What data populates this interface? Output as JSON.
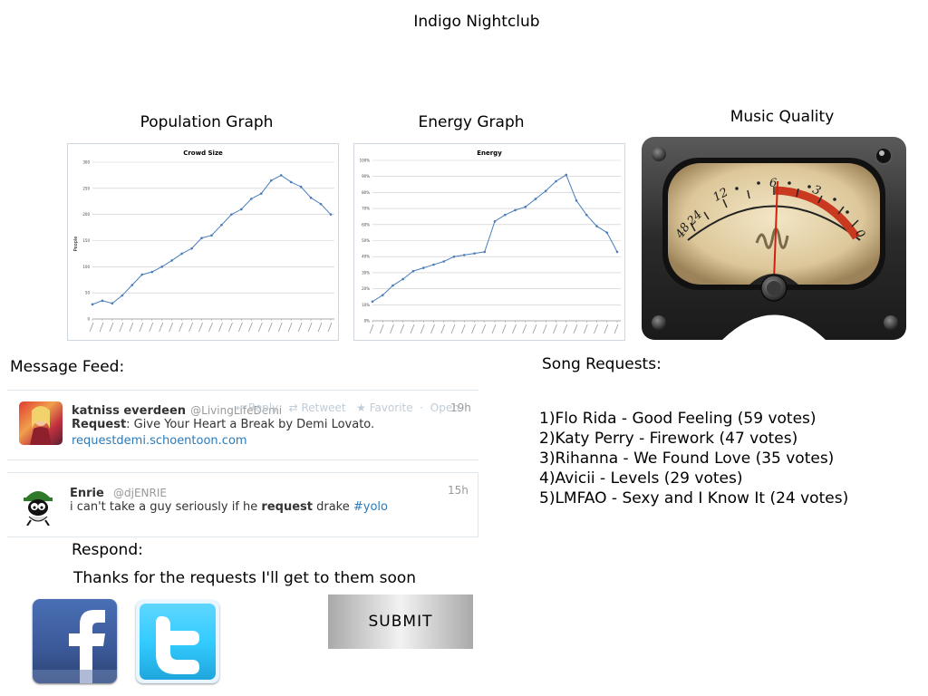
{
  "page": {
    "title": "Indigo Nightclub"
  },
  "population_graph": {
    "heading": "Population Graph"
  },
  "energy_graph": {
    "heading": "Energy Graph"
  },
  "music_quality": {
    "heading": "Music Quality",
    "meter_scale": [
      "48",
      "24",
      "12",
      "6",
      "3",
      "0"
    ]
  },
  "chart_data": [
    {
      "type": "line",
      "title": "Crowd Size",
      "ylabel": "People",
      "ylim": [
        0,
        300
      ],
      "yticks": [
        0,
        50,
        100,
        150,
        200,
        250,
        300
      ],
      "values": [
        28,
        35,
        30,
        45,
        65,
        85,
        90,
        100,
        112,
        125,
        135,
        155,
        160,
        180,
        200,
        210,
        230,
        240,
        265,
        275,
        262,
        253,
        232,
        220,
        200
      ],
      "color": "#4a7ebb"
    },
    {
      "type": "line",
      "title": "Energy",
      "ylim": [
        0,
        100
      ],
      "yticks": [
        "0%",
        "10%",
        "20%",
        "30%",
        "40%",
        "50%",
        "60%",
        "70%",
        "80%",
        "90%",
        "100%"
      ],
      "values": [
        12,
        16,
        22,
        26,
        31,
        33,
        35,
        37,
        40,
        41,
        42,
        43,
        62,
        66,
        69,
        71,
        76,
        81,
        87,
        91,
        75,
        66,
        59,
        55,
        43
      ],
      "color": "#4a7ebb"
    }
  ],
  "message_feed": {
    "label": "Message Feed:",
    "tweets": [
      {
        "name": "katniss everdeen",
        "handle": "@LivingLifeDemi",
        "time": "19h",
        "text_bold": "Request",
        "text_rest": ": Give Your Heart a Break by Demi Lovato.",
        "link": "requestdemi.schoentoon.com",
        "actions": [
          "Reply",
          "Retweet",
          "Favorite",
          "·",
          "Open"
        ]
      },
      {
        "name": "Enrie",
        "handle": "@djENRIE",
        "time": "15h",
        "text_pre": "i can't take a guy seriously if he ",
        "text_bold": "request",
        "text_post": " drake ",
        "hashtag": "#yolo"
      }
    ]
  },
  "respond": {
    "label": "Respond:",
    "message": "Thanks for the requests I'll get to them soon",
    "submit_label": "SUBMIT"
  },
  "social": {
    "facebook_icon": "facebook-icon",
    "twitter_icon": "twitter-icon",
    "facebook_color": "#3b5998",
    "twitter_color": "#33ccff"
  },
  "song_requests": {
    "label": "Song Requests:",
    "items": [
      "1)Flo Rida - Good Feeling  (59 votes)",
      "2)Katy Perry - Firework (47 votes)",
      "3)Rihanna - We Found Love (35 votes)",
      "4)Avicii - Levels (29 votes)",
      "5)LMFAO - Sexy and I Know It (24 votes)"
    ]
  }
}
